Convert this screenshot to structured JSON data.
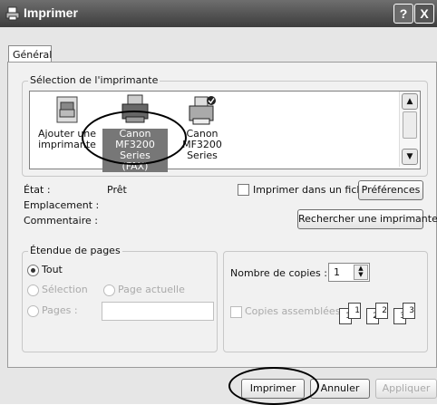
{
  "window": {
    "title": "Imprimer",
    "help_btn": "?",
    "close_btn": "X"
  },
  "tab": {
    "label": "Général"
  },
  "printer_section": {
    "legend": "Sélection de l'imprimante",
    "items": [
      {
        "line1": "Ajouter une",
        "line2": "imprimante",
        "icon": "add-printer-icon"
      },
      {
        "line1": "Canon",
        "line2": "MF3200 Series",
        "line3": "(FAX)",
        "icon": "fax-printer-icon",
        "selected": true
      },
      {
        "line1": "Canon",
        "line2": "MF3200 Series",
        "icon": "default-printer-icon"
      }
    ]
  },
  "status": {
    "state_label": "État :",
    "state_value": "Prêt",
    "location_label": "Emplacement :",
    "comment_label": "Commentaire :",
    "print_to_file": "Imprimer dans un fichier",
    "preferences_btn": "Préférences",
    "find_printer_btn": "Rechercher une imprimante..."
  },
  "range": {
    "legend": "Étendue de pages",
    "all": "Tout",
    "selection": "Sélection",
    "current_page": "Page actuelle",
    "pages": "Pages :"
  },
  "copies": {
    "label": "Nombre de copies :",
    "value": "1",
    "collate": "Copies assemblées",
    "sheets_a": [
      "1",
      "1"
    ],
    "sheets_b": [
      "2",
      "2"
    ],
    "sheets_c": [
      "3",
      "3"
    ]
  },
  "footer": {
    "print_btn": "Imprimer",
    "cancel_btn": "Annuler",
    "apply_btn": "Appliquer"
  }
}
